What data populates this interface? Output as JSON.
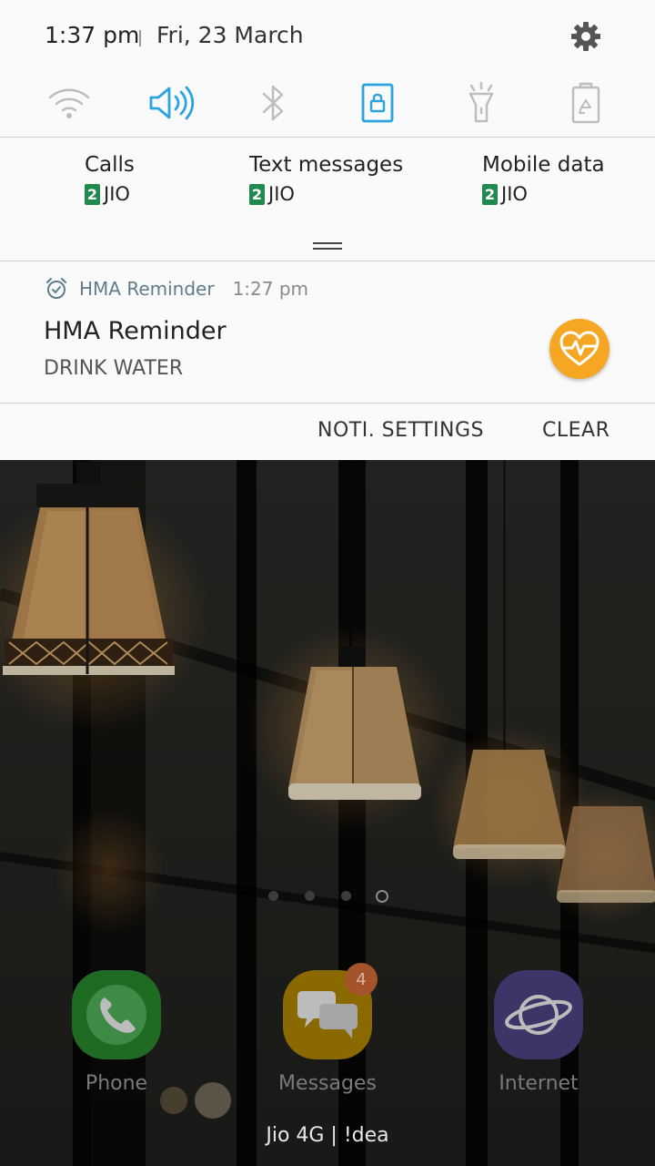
{
  "status": {
    "time": "1:37 pm",
    "date": "Fri, 23 March",
    "settings_icon": "gear-icon"
  },
  "quick_settings": [
    {
      "name": "wifi-icon",
      "active": false
    },
    {
      "name": "sound-icon",
      "active": true
    },
    {
      "name": "bluetooth-icon",
      "active": false
    },
    {
      "name": "screen-rotation-lock-icon",
      "active": true
    },
    {
      "name": "flashlight-icon",
      "active": false
    },
    {
      "name": "power-saving-icon",
      "active": false
    }
  ],
  "sim": {
    "calls": {
      "label": "Calls",
      "slot": "2",
      "carrier": "JIO"
    },
    "texts": {
      "label": "Text messages",
      "slot": "2",
      "carrier": "JIO"
    },
    "data": {
      "label": "Mobile data",
      "slot": "2",
      "carrier": "JIO"
    }
  },
  "notification": {
    "app_name": "HMA Reminder",
    "time": "1:27 pm",
    "title": "HMA Reminder",
    "body": "DRINK WATER",
    "icon": "heartbeat-icon",
    "icon_color": "#f5a623"
  },
  "actions": {
    "settings_label": "NOTI. SETTINGS",
    "clear_label": "CLEAR"
  },
  "home": {
    "page_count": 4,
    "active_page": 4,
    "dock": [
      {
        "label": "Phone",
        "icon": "phone-icon",
        "color": "#1f6b24"
      },
      {
        "label": "Messages",
        "icon": "messages-icon",
        "color": "#8a6a00",
        "badge": "4"
      },
      {
        "label": "Internet",
        "icon": "internet-icon",
        "color": "#3d3568"
      }
    ],
    "carrier_text": "Jio 4G | !dea"
  },
  "colors": {
    "accent": "#2aa3de",
    "inactive_icon": "#bdbdbd",
    "sim_badge": "#1f8a4c"
  }
}
